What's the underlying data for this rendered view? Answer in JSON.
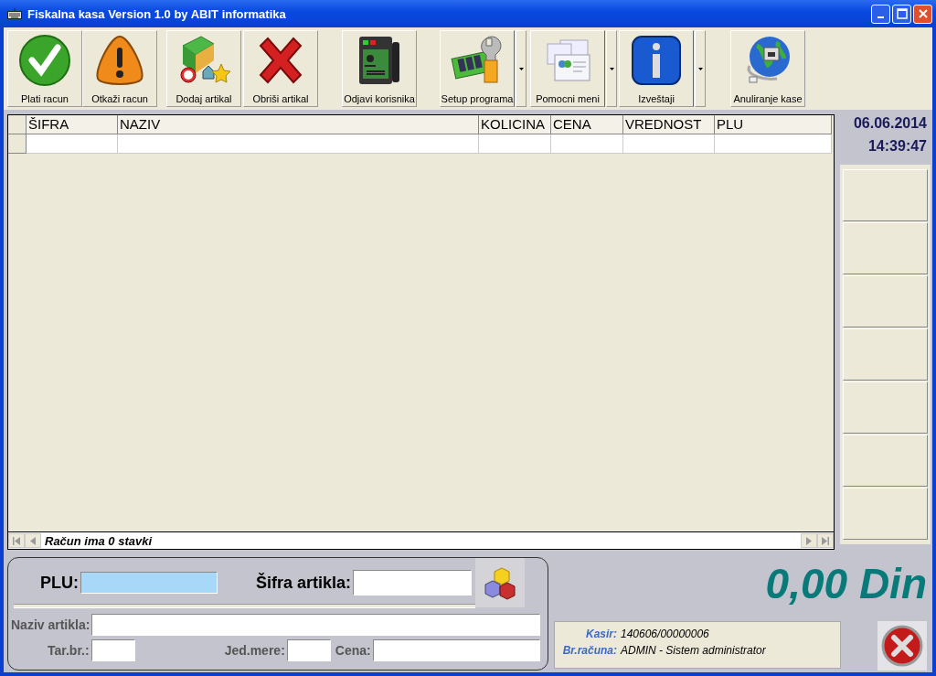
{
  "window": {
    "title": "Fiskalna kasa Version 1.0 by ABIT informatika"
  },
  "toolbar": [
    {
      "label": "Plati racun",
      "dropdown": false
    },
    {
      "label": "Otkaži racun",
      "dropdown": false
    },
    {
      "label": "Dodaj artikal",
      "dropdown": false
    },
    {
      "label": "Obriši artikal",
      "dropdown": false
    },
    {
      "label": "Odjavi korisnika",
      "dropdown": false
    },
    {
      "label": "Setup programa",
      "dropdown": true
    },
    {
      "label": "Pomocni meni",
      "dropdown": true
    },
    {
      "label": "Izveštaji",
      "dropdown": true
    },
    {
      "label": "Anuliranje kase",
      "dropdown": false
    }
  ],
  "grid": {
    "columns": [
      "ŠIFRA",
      "NAZIV",
      "KOLICINA",
      "CENA",
      "VREDNOST",
      "PLU"
    ],
    "footer": "Račun ima 0 stavki"
  },
  "clock": {
    "date": "06.06.2014",
    "time": "14:39:47"
  },
  "form": {
    "plu": "PLU:",
    "sifra": "Šifra artikla:",
    "naziv": "Naziv artikla:",
    "tar": "Tar.br.:",
    "jed": "Jed.mere:",
    "cena": "Cena:"
  },
  "total": "0,00 Din",
  "info": [
    {
      "label": "Kasir:",
      "value": "140606/00000006"
    },
    {
      "label": "Br.računa:",
      "value": "ADMIN - Sistem administrator"
    }
  ]
}
